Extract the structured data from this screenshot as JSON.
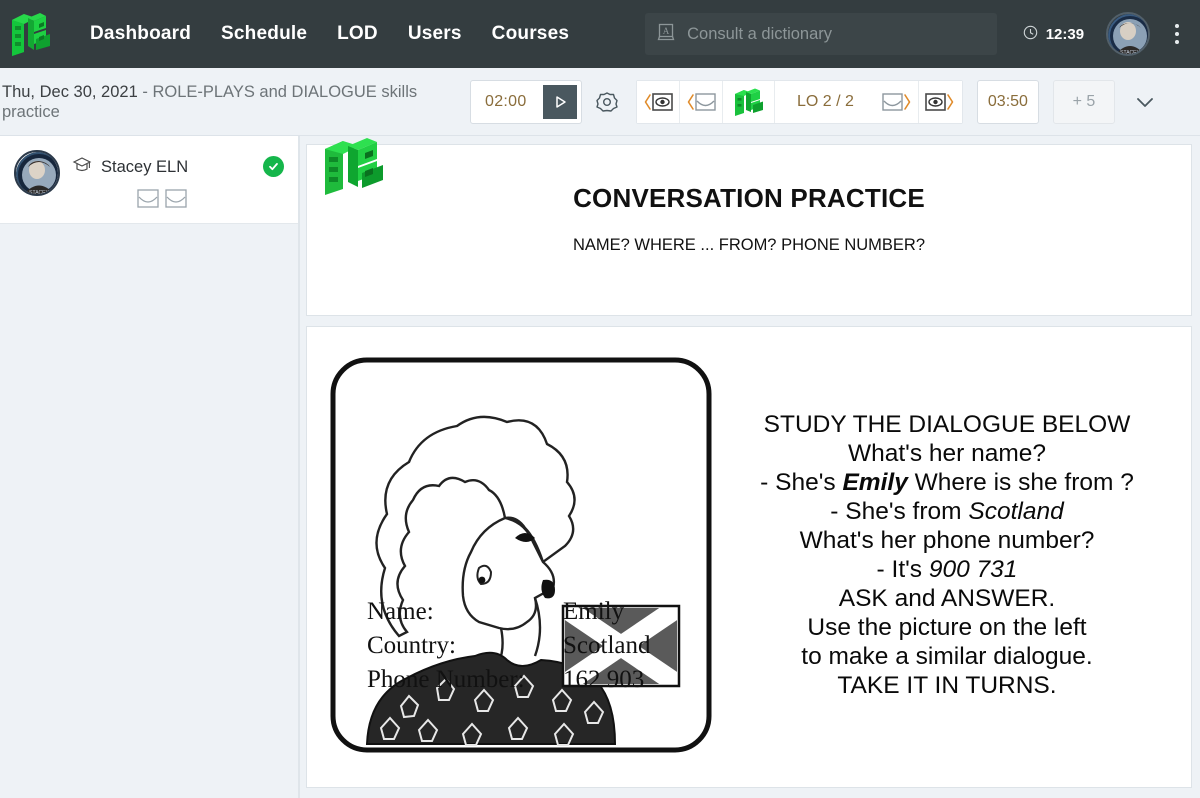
{
  "app": {
    "logo_name": "el-green-logo",
    "header_bg": "#343d40",
    "page_bg": "#eef2f6",
    "accent_green": "#15b64b",
    "amber_text": "#8a6d3b"
  },
  "topnav": {
    "links": [
      {
        "label": "Dashboard",
        "name": "nav-dashboard"
      },
      {
        "label": "Schedule",
        "name": "nav-schedule"
      },
      {
        "label": "LOD",
        "name": "nav-lod"
      },
      {
        "label": "Users",
        "name": "nav-users"
      },
      {
        "label": "Courses",
        "name": "nav-courses"
      }
    ],
    "search": {
      "placeholder": "Consult a dictionary",
      "icon": "dictionary-icon"
    },
    "clock": {
      "icon": "clock-icon",
      "time": "12:39"
    },
    "avatar_alt": "STACEY",
    "menu_icon": "kebab-menu-icon"
  },
  "subbar": {
    "date": "Thu, Dec 30, 2021",
    "separator": " - ",
    "lesson": "ROLE-PLAYS and DIALOGUE skills practice",
    "timer": "02:00",
    "play_icon": "play-icon",
    "settings_icon": "gear-icon",
    "prev_eye_icon": "prev-eye-icon",
    "prev_slide_icon": "prev-slide-icon",
    "book_icon": "green-book-icon",
    "lo_label": "LO 2 / 2",
    "next_slide_icon": "next-slide-icon",
    "next_eye_icon": "next-eye-icon",
    "elapsed": "03:50",
    "extra": "+ 5",
    "chevron_icon": "chevron-down-icon"
  },
  "sidebar": {
    "user": {
      "name": "Stacey ELN",
      "role_icon": "graduate-cap-icon",
      "status_icon": "check-circle-icon",
      "actions": [
        "slide-icon-1",
        "slide-icon-2"
      ]
    }
  },
  "slide_header": {
    "title": "CONVERSATION PRACTICE",
    "subtitle": "NAME? WHERE ... FROM? PHONE NUMBER?",
    "logo_name": "el-green-logo"
  },
  "slide_main": {
    "picture": {
      "name": "woman-profile-scotland-illustration",
      "flag": "scotland-saltire-flag",
      "fields": [
        {
          "label": "Name:",
          "value": "Emily"
        },
        {
          "label": "Country:",
          "value": "Scotland"
        },
        {
          "label": "Phone Number:",
          "value": "162 903"
        }
      ]
    },
    "dialogue_lines": [
      {
        "type": "plain",
        "text": "STUDY THE DIALOGUE BELOW"
      },
      {
        "type": "plain",
        "text": "What's her name?"
      },
      {
        "type": "mixed",
        "pre": "- She's ",
        "em": "Emily",
        "post": " Where is she from ?"
      },
      {
        "type": "mixed",
        "pre": "- She's from ",
        "em": "Scotland",
        "post": ""
      },
      {
        "type": "plain",
        "text": "What's her phone number?"
      },
      {
        "type": "mixed",
        "pre": "- It's ",
        "em": "900 731",
        "post": ""
      },
      {
        "type": "plain",
        "text": "ASK and ANSWER."
      },
      {
        "type": "plain",
        "text": "Use the picture on the left"
      },
      {
        "type": "plain",
        "text": "to make a similar dialogue."
      },
      {
        "type": "plain",
        "text": "TAKE IT IN TURNS."
      }
    ]
  }
}
